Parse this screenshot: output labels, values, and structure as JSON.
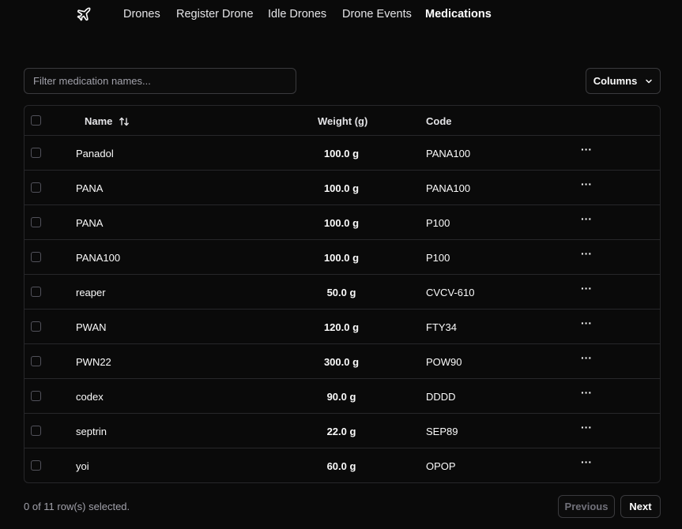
{
  "nav": {
    "logo_icon": "airplane-icon",
    "links": [
      {
        "label": "Drones"
      },
      {
        "label": "Register Drone"
      },
      {
        "label": "Idle Drones"
      },
      {
        "label": "Drone Events"
      },
      {
        "label": "Medications",
        "active": true
      }
    ]
  },
  "toolbar": {
    "filter_placeholder": "Filter medication names...",
    "columns_label": "Columns"
  },
  "table": {
    "headers": {
      "name": "Name",
      "weight": "Weight (g)",
      "code": "Code"
    },
    "rows": [
      {
        "name": "Panadol",
        "weight": "100.0 g",
        "code": "PANA100"
      },
      {
        "name": "PANA",
        "weight": "100.0 g",
        "code": "PANA100"
      },
      {
        "name": "PANA",
        "weight": "100.0 g",
        "code": "P100"
      },
      {
        "name": "PANA100",
        "weight": "100.0 g",
        "code": "P100"
      },
      {
        "name": "reaper",
        "weight": "50.0 g",
        "code": "CVCV-610"
      },
      {
        "name": "PWAN",
        "weight": "120.0 g",
        "code": "FTY34"
      },
      {
        "name": "PWN22",
        "weight": "300.0 g",
        "code": "POW90"
      },
      {
        "name": "codex",
        "weight": "90.0 g",
        "code": "DDDD"
      },
      {
        "name": "septrin",
        "weight": "22.0 g",
        "code": "SEP89"
      },
      {
        "name": "yoi",
        "weight": "60.0 g",
        "code": "OPOP"
      }
    ],
    "row_action_icon": "ellipsis-icon"
  },
  "footer": {
    "selection_text": "0 of 11 row(s) selected.",
    "previous_label": "Previous",
    "next_label": "Next"
  }
}
